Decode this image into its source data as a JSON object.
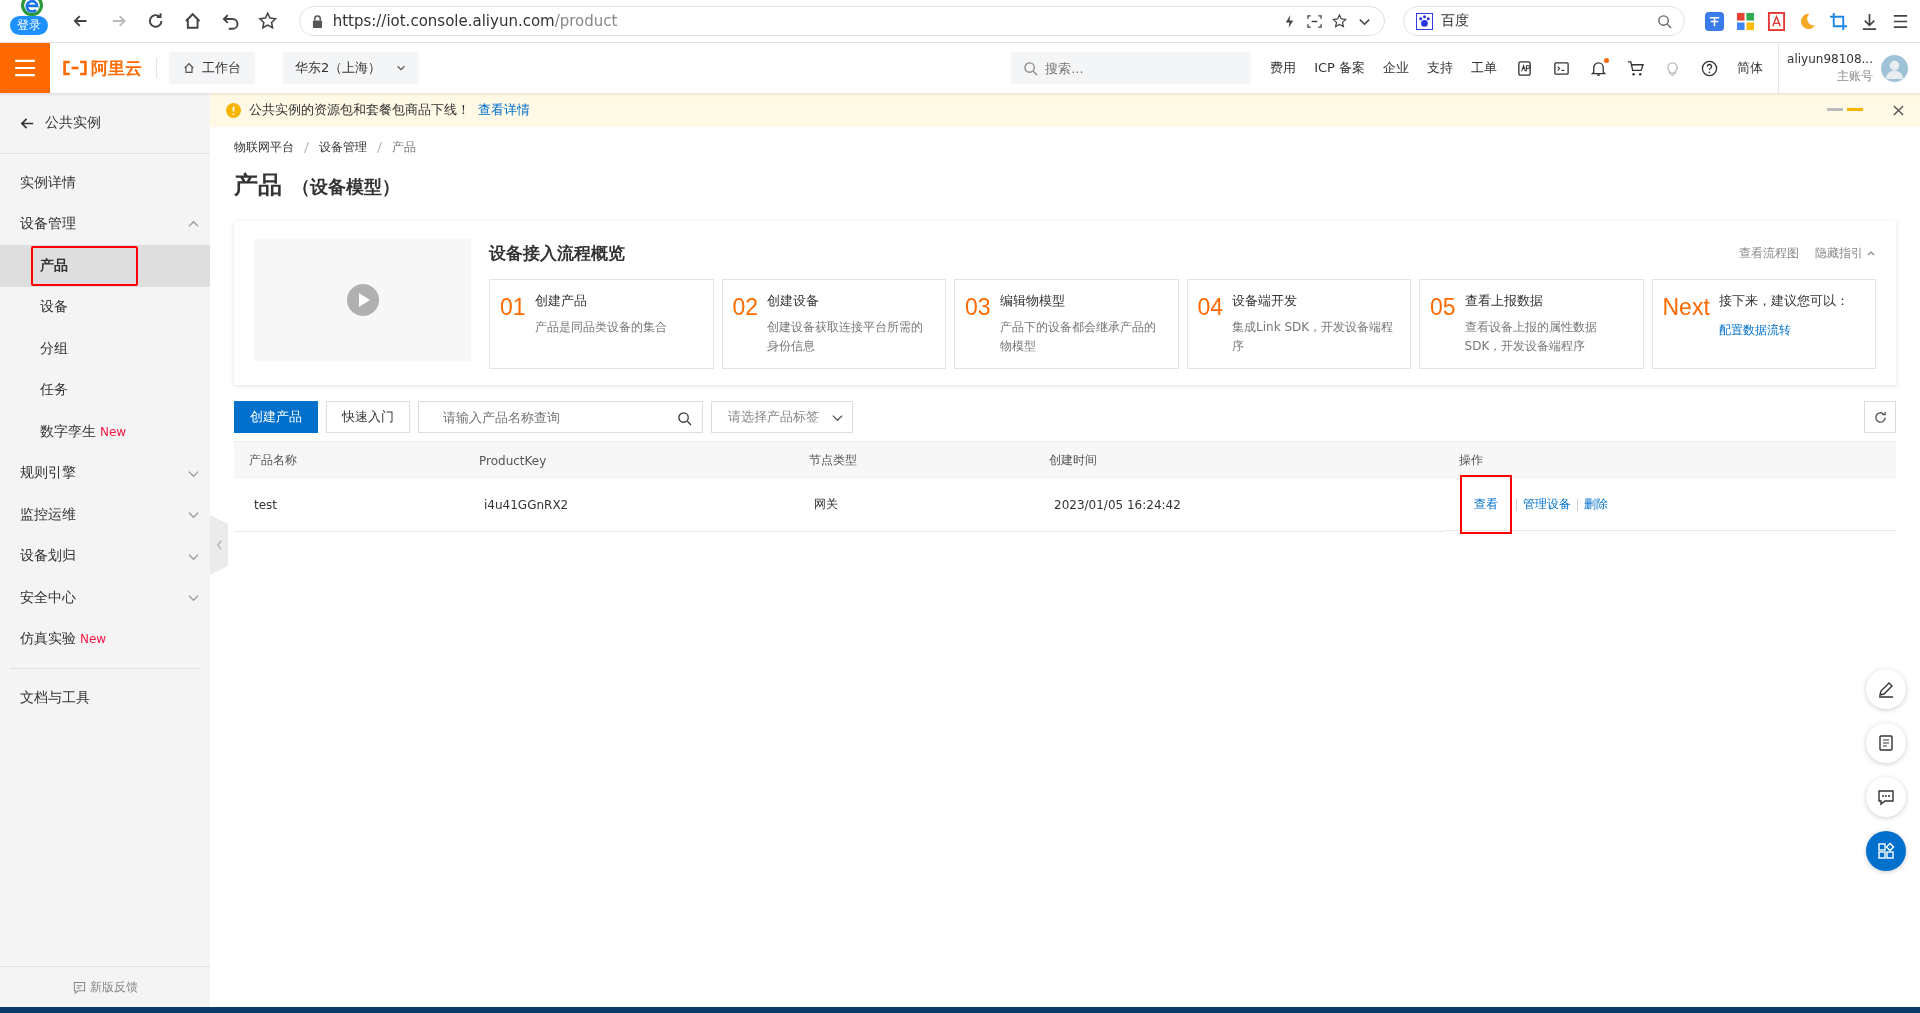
{
  "browser": {
    "login_badge": "登录",
    "url_host": "https://iot.console.aliyun.com",
    "url_path": "/product",
    "search_engine": "百度"
  },
  "header": {
    "logo_text": "阿里云",
    "workbench": "工作台",
    "region": "华东2（上海）",
    "search_placeholder": "搜索...",
    "nav": [
      "费用",
      "ICP 备案",
      "企业",
      "支持",
      "工单"
    ],
    "language": "简体",
    "user_name": "aliyun98108...",
    "account_type": "主账号",
    "notification_dot": true
  },
  "sidebar": {
    "back": "公共实例",
    "items": [
      {
        "label": "实例详情",
        "selected": false
      },
      {
        "label": "设备管理",
        "selected": false,
        "expanded": true,
        "children": [
          {
            "label": "产品",
            "selected": true,
            "highlighted": true
          },
          {
            "label": "设备",
            "selected": false,
            "highlighted": false
          },
          {
            "label": "分组",
            "selected": false,
            "highlighted": false
          },
          {
            "label": "任务",
            "selected": false,
            "highlighted": false
          },
          {
            "label": "数字孪生",
            "badge": "New",
            "selected": false,
            "highlighted": false
          }
        ]
      },
      {
        "label": "规则引擎",
        "selected": false,
        "expanded": false
      },
      {
        "label": "监控运维",
        "selected": false,
        "expanded": false
      },
      {
        "label": "设备划归",
        "selected": false,
        "expanded": false
      },
      {
        "label": "安全中心",
        "selected": false,
        "expanded": false
      },
      {
        "label": "仿真实验",
        "badge": "New",
        "selected": false
      }
    ],
    "bottom_items": [
      "文档与工具"
    ],
    "feedback": "新版反馈"
  },
  "notice": {
    "text": "公共实例的资源包和套餐包商品下线！",
    "link": "查看详情"
  },
  "breadcrumb": [
    "物联网平台",
    "设备管理",
    "产品"
  ],
  "page_title": "产品",
  "page_subtitle": "（设备模型）",
  "guide": {
    "title": "设备接入流程概览",
    "links": [
      "查看流程图",
      "隐藏指引"
    ],
    "steps": [
      {
        "kind": "step",
        "number": "01",
        "title": "创建产品",
        "desc": "产品是同品类设备的集合"
      },
      {
        "kind": "step",
        "number": "02",
        "title": "创建设备",
        "desc": "创建设备获取连接平台所需的身份信息"
      },
      {
        "kind": "step",
        "number": "03",
        "title": "编辑物模型",
        "desc": "产品下的设备都会继承产品的物模型"
      },
      {
        "kind": "step",
        "number": "04",
        "title": "设备端开发",
        "desc": "集成Link SDK，开发设备端程序"
      },
      {
        "kind": "step",
        "number": "05",
        "title": "查看上报数据",
        "desc": "查看设备上报的属性数据 SDK，开发设备端程序"
      },
      {
        "kind": "next",
        "number": "Next",
        "title": "接下来，建议您可以：",
        "link": "配置数据流转"
      }
    ]
  },
  "toolbar": {
    "create": "创建产品",
    "quick_start": "快速入门",
    "search_placeholder": "请输入产品名称查询",
    "tag_placeholder": "请选择产品标签"
  },
  "table": {
    "columns": [
      "产品名称",
      "ProductKey",
      "节点类型",
      "创建时间",
      "操作"
    ],
    "rows": [
      {
        "name": "test",
        "product_key": "i4u41GGnRX2",
        "node_type": "网关",
        "created": "2023/01/05 16:24:42",
        "actions": [
          {
            "label": "查看",
            "highlighted": true
          },
          {
            "label": "管理设备",
            "highlighted": false
          },
          {
            "label": "删除",
            "highlighted": false
          }
        ]
      }
    ]
  }
}
